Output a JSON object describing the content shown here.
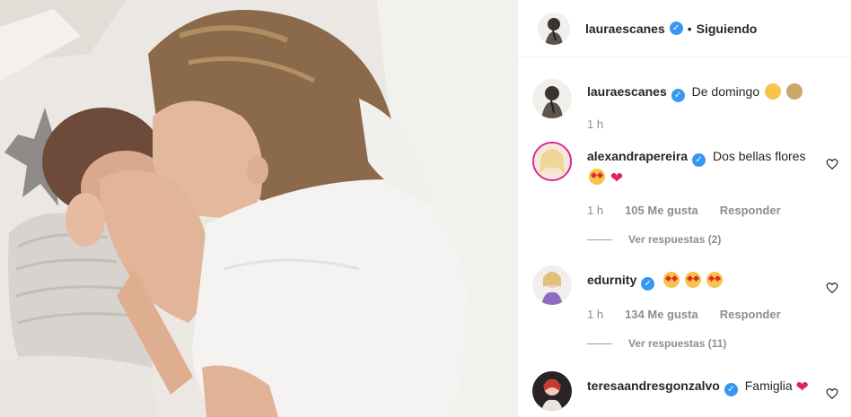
{
  "post": {
    "author": "lauraescanes",
    "follow_state": "Siguiendo",
    "caption": "De domingo",
    "caption_time": "1 h"
  },
  "comments": [
    {
      "user": "alexandrapereira",
      "text": "Dos bellas flores",
      "time": "1 h",
      "likes": "105 Me gusta",
      "reply": "Responder",
      "view_replies": "Ver respuestas (2)"
    },
    {
      "user": "edurnity",
      "text": "",
      "time": "1 h",
      "likes": "134 Me gusta",
      "reply": "Responder",
      "view_replies": "Ver respuestas (11)"
    },
    {
      "user": "teresaandresgonzalvo",
      "text": "Famiglia",
      "time": "",
      "likes": "",
      "reply": "",
      "view_replies": ""
    }
  ],
  "icons": {
    "verified": "verified-badge-icon",
    "like": "heart-outline-icon"
  },
  "colors": {
    "verified": "#3897f0",
    "secondary_text": "#8e8e8e",
    "heart": "#e0245e"
  }
}
